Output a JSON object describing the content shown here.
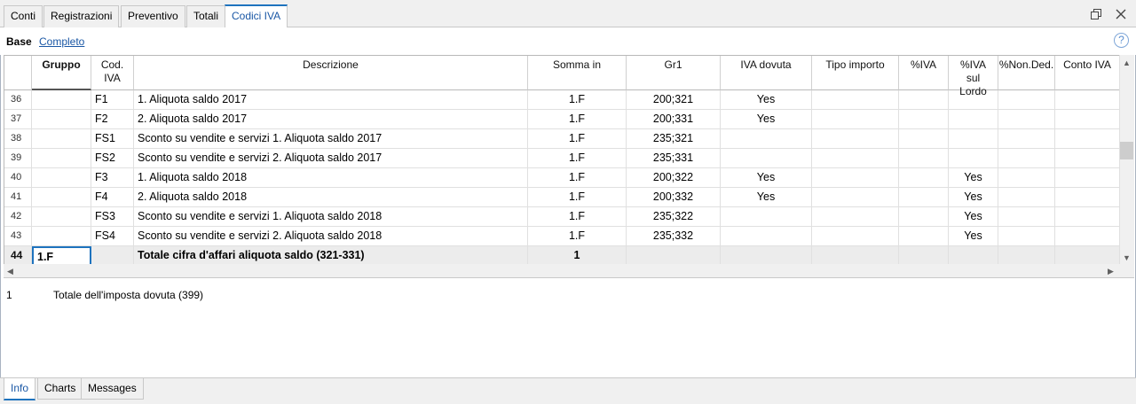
{
  "tabs": [
    "Conti",
    "Registrazioni",
    "Preventivo",
    "Totali",
    "Codici IVA"
  ],
  "views": {
    "base": "Base",
    "full": "Completo"
  },
  "help_glyph": "?",
  "columns": {
    "gruppo": "Gruppo",
    "cod_iva": "Cod. IVA",
    "descrizione": "Descrizione",
    "somma_in": "Somma in",
    "gr1": "Gr1",
    "iva_dovuta": "IVA dovuta",
    "tipo_importo": "Tipo importo",
    "pct_iva": "%IVA",
    "pct_iva_lordo": "%IVA sul Lordo",
    "pct_non_ded": "%Non.Ded.",
    "conto_iva": "Conto IVA"
  },
  "rows": [
    {
      "n": "36",
      "gruppo": "",
      "cod": "F1",
      "desc": "1. Aliquota saldo 2017",
      "somma": "1.F",
      "gr1": "200;321",
      "ivadov": "Yes",
      "lordo": ""
    },
    {
      "n": "37",
      "gruppo": "",
      "cod": "F2",
      "desc": "2. Aliquota saldo 2017",
      "somma": "1.F",
      "gr1": "200;331",
      "ivadov": "Yes",
      "lordo": ""
    },
    {
      "n": "38",
      "gruppo": "",
      "cod": "FS1",
      "desc": "Sconto su vendite e servizi 1. Aliquota saldo 2017",
      "somma": "1.F",
      "gr1": "235;321",
      "ivadov": "",
      "lordo": ""
    },
    {
      "n": "39",
      "gruppo": "",
      "cod": "FS2",
      "desc": "Sconto su vendite e servizi 2. Aliquota saldo 2017",
      "somma": "1.F",
      "gr1": "235;331",
      "ivadov": "",
      "lordo": ""
    },
    {
      "n": "40",
      "gruppo": "",
      "cod": "F3",
      "desc": "1. Aliquota saldo 2018",
      "somma": "1.F",
      "gr1": "200;322",
      "ivadov": "Yes",
      "lordo": "Yes"
    },
    {
      "n": "41",
      "gruppo": "",
      "cod": "F4",
      "desc": "2. Aliquota saldo 2018",
      "somma": "1.F",
      "gr1": "200;332",
      "ivadov": "Yes",
      "lordo": "Yes"
    },
    {
      "n": "42",
      "gruppo": "",
      "cod": "FS3",
      "desc": "Sconto su vendite e servizi 1. Aliquota saldo 2018",
      "somma": "1.F",
      "gr1": "235;322",
      "ivadov": "",
      "lordo": "Yes"
    },
    {
      "n": "43",
      "gruppo": "",
      "cod": "FS4",
      "desc": "Sconto su vendite e servizi 2. Aliquota saldo 2018",
      "somma": "1.F",
      "gr1": "235;332",
      "ivadov": "",
      "lordo": "Yes"
    }
  ],
  "total_row": {
    "n": "44",
    "gruppo": "1.F",
    "cod": "",
    "desc": "Totale cifra d'affari aliquota saldo (321-331)",
    "somma": "1"
  },
  "info": {
    "num": "1",
    "text": "Totale dell'imposta dovuta (399)"
  },
  "bottom_tabs": [
    "Info",
    "Charts",
    "Messages"
  ],
  "colors": {
    "accent": "#1e73be",
    "link": "#1a57a5",
    "total_bg": "#ececec"
  },
  "icons": [
    "restore-window-icon",
    "close-icon",
    "help-icon",
    "scroll-up-icon",
    "scroll-down-icon",
    "scroll-left-icon",
    "scroll-right-icon"
  ]
}
